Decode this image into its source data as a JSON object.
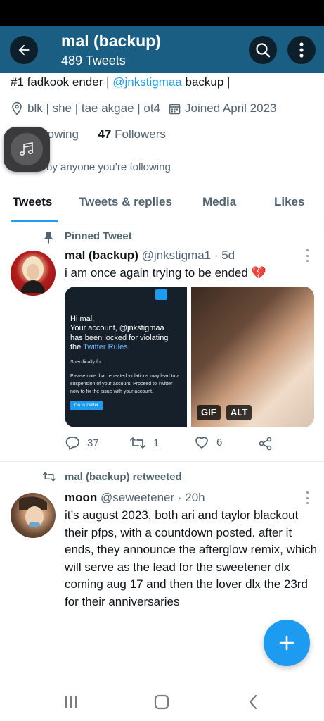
{
  "header": {
    "title": "mal (backup)",
    "subtitle": "489 Tweets"
  },
  "profile": {
    "bio_prefix": "#1 fadkook ender | ",
    "bio_mention": "@jnkstigmaa",
    "bio_suffix": " backup |",
    "location": "blk | she | tae akgae | ot4",
    "joined": "Joined April 2023",
    "following_label": "llowing",
    "followers_count": "47",
    "followers_label": "Followers",
    "not_followed_text": "owed by anyone you’re following"
  },
  "tabs": [
    {
      "label": "Tweets",
      "active": true
    },
    {
      "label": "Tweets & replies",
      "active": false
    },
    {
      "label": "Media",
      "active": false
    },
    {
      "label": "Likes",
      "active": false
    }
  ],
  "tweets": [
    {
      "context_label": "Pinned Tweet",
      "name": "mal (backup)",
      "handle_time": "@jnkstigma1 · 5d",
      "text": "i am once again trying to be ended 💔",
      "media": {
        "left": {
          "greeting": "Hi mal,",
          "line1": "Your account, @jnkstigmaa",
          "line2": "has been locked for violating",
          "line3_prefix": "the ",
          "line3_link": "Twitter Rules",
          "line3_suffix": ".",
          "specifically": "Specifically for:",
          "notice": "Please note that repeated violations may lead to a suspension of your account. Proceed to Twitter now to fix the issue with your account.",
          "button": "Go to Twitter"
        },
        "right": {
          "gif_badge": "GIF",
          "alt_badge": "ALT"
        }
      },
      "replies": "37",
      "retweets": "1",
      "likes": "6"
    },
    {
      "context_label": "mal (backup) retweeted",
      "name": "moon",
      "handle_time": "@seweetener · 20h",
      "text": "it’s august 2023, both ari and taylor blackout their pfps, with a countdown posted. after it ends, they announce the afterglow remix, which will serve as the lead for the sweetener dlx coming aug 17 and then the lover dlx the 23rd for their anniversaries"
    }
  ],
  "colors": {
    "header_bg": "#1a5f83",
    "accent": "#1d9bf0",
    "muted": "#536471"
  }
}
